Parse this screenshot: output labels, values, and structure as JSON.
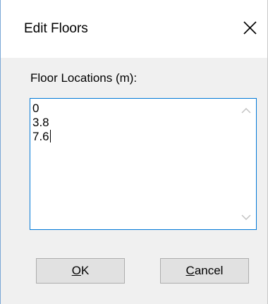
{
  "window": {
    "title": "Edit Floors"
  },
  "field": {
    "label": "Floor Locations (m):",
    "lines": [
      "0",
      "3.8",
      "7.6"
    ]
  },
  "buttons": {
    "ok": {
      "mnemonic": "O",
      "rest": "K"
    },
    "cancel": {
      "mnemonic": "C",
      "rest": "ancel"
    }
  },
  "colors": {
    "focus_border": "#0078d7",
    "dialog_bg": "#f0f0f0",
    "button_bg": "#e1e1e1",
    "button_border": "#adadad",
    "scroll_arrow_disabled": "#c0c0c0"
  },
  "icons": {
    "close": "close-icon",
    "scroll_up": "chevron-up-icon",
    "scroll_down": "chevron-down-icon"
  }
}
